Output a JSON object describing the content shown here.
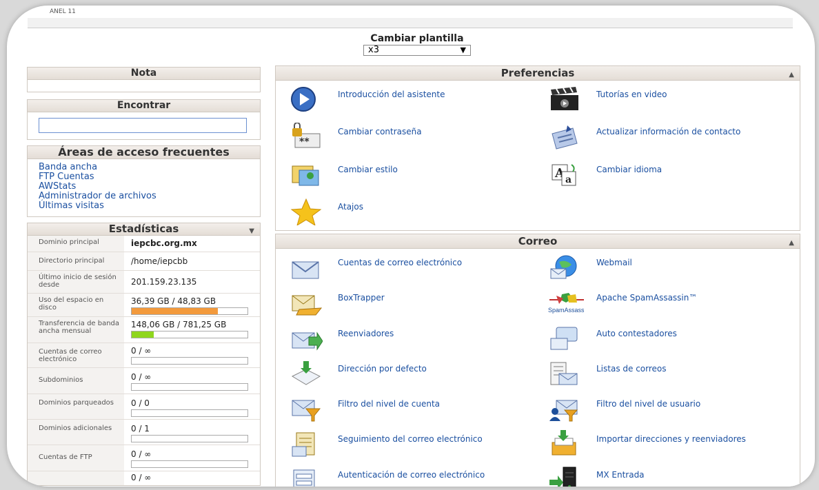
{
  "corner_label": "ANEL 11",
  "plantilla": {
    "label": "Cambiar plantilla",
    "selected": "x3"
  },
  "nota": {
    "title": "Nota"
  },
  "encontrar": {
    "title": "Encontrar",
    "value": ""
  },
  "frecuentes": {
    "title": "Áreas de acceso frecuentes",
    "links": [
      "Banda ancha",
      "FTP Cuentas",
      "AWStats",
      "Administrador de archivos",
      "Últimas visitas"
    ]
  },
  "estadisticas": {
    "title": "Estadísticas",
    "rows": [
      {
        "key": "Dominio principal",
        "value": "iepcbc.org.mx"
      },
      {
        "key": "Directorio principal",
        "value": "/home/iepcbb"
      },
      {
        "key": "Último inicio de sesión desde",
        "value": "201.159.23.135"
      },
      {
        "key": "Uso del espacio en disco",
        "value": "36,39 GB / 48,83 GB",
        "fill": 0.745,
        "color": "#f39a3c"
      },
      {
        "key": "Transferencia de banda ancha mensual",
        "value": "148,06 GB / 781,25 GB",
        "fill": 0.19,
        "color": "#8fd61e"
      },
      {
        "key": "Cuentas de correo electrónico",
        "value": "0 / ∞",
        "fill": 0
      },
      {
        "key": "Subdominios",
        "value": "0 / ∞",
        "fill": 0
      },
      {
        "key": "Dominios parqueados",
        "value": "0 / 0",
        "fill": 0
      },
      {
        "key": "Dominios adicionales",
        "value": "0 / 1",
        "fill": 0
      },
      {
        "key": "Cuentas de FTP",
        "value": "0 / ∞",
        "fill": 0
      },
      {
        "key": "",
        "value": "0 / ∞"
      }
    ]
  },
  "preferencias": {
    "title": "Preferencias",
    "items": [
      {
        "label": "Introducción del asistente",
        "icon": "play-icon"
      },
      {
        "label": "Tutorías en video",
        "icon": "clapperboard-icon"
      },
      {
        "label": "Cambiar contraseña",
        "icon": "lock-password-icon"
      },
      {
        "label": "Actualizar información de contacto",
        "icon": "contact-card-icon"
      },
      {
        "label": "Cambiar estilo",
        "icon": "style-icon"
      },
      {
        "label": "Cambiar idioma",
        "icon": "language-icon"
      },
      {
        "label": "Atajos",
        "icon": "star-icon"
      }
    ]
  },
  "correo": {
    "title": "Correo",
    "items": [
      {
        "label": "Cuentas de correo electrónico",
        "icon": "envelope-icon"
      },
      {
        "label": "Webmail",
        "icon": "globe-mail-icon"
      },
      {
        "label": "BoxTrapper",
        "icon": "boxtrapper-icon"
      },
      {
        "label": "Apache SpamAssassin™",
        "icon": "spamassassin-icon"
      },
      {
        "label": "Reenviadores",
        "icon": "forward-mail-icon"
      },
      {
        "label": "Auto contestadores",
        "icon": "autoresponder-icon"
      },
      {
        "label": "Dirección por defecto",
        "icon": "default-address-icon"
      },
      {
        "label": "Listas de correos",
        "icon": "mailing-list-icon"
      },
      {
        "label": "Filtro del nivel de cuenta",
        "icon": "account-filter-icon"
      },
      {
        "label": "Filtro del nivel de usuario",
        "icon": "user-filter-icon"
      },
      {
        "label": "Seguimiento del correo electrónico",
        "icon": "email-trace-icon"
      },
      {
        "label": "Importar direcciones y reenviadores",
        "icon": "import-icon"
      },
      {
        "label": "Autenticación de correo electrónico",
        "icon": "email-auth-icon"
      },
      {
        "label": "MX Entrada",
        "icon": "server-icon"
      }
    ]
  },
  "spamassassin_logo_text": "SpamAssassin"
}
